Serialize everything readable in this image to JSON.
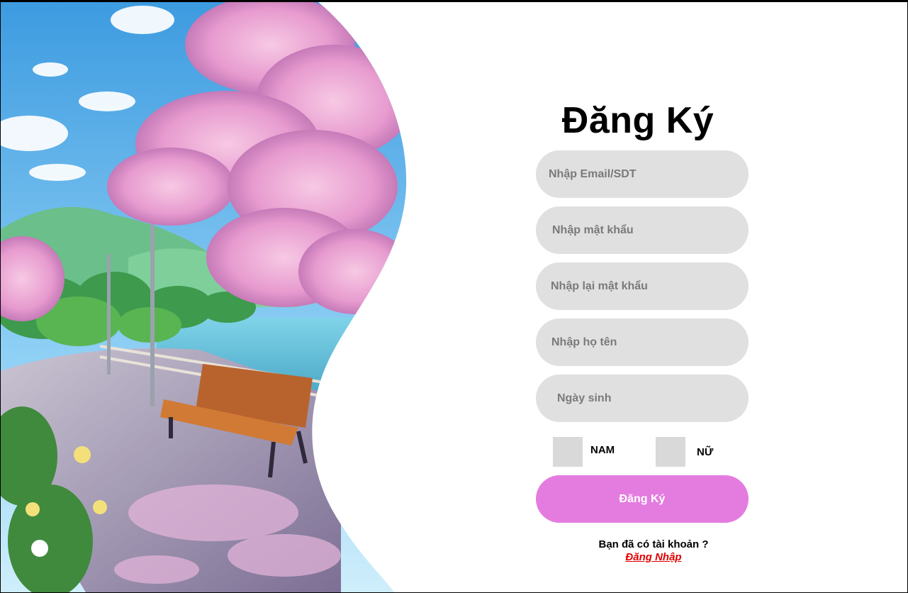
{
  "form": {
    "title": "Đăng Ký",
    "email_placeholder": "Nhập Email/SDT",
    "password_placeholder": "Nhập mật khẩu",
    "confirm_password_placeholder": "Nhập lại mật khẩu",
    "fullname_placeholder": "Nhập họ tên",
    "birthday_placeholder": "Ngày sinh",
    "gender_male_label": "NAM",
    "gender_female_label": "NỮ",
    "submit_label": "Đăng Ký",
    "have_account_text": "Bạn đã có tài khoản ?",
    "login_link_label": "Đăng Nhập"
  },
  "colors": {
    "field_bg": "#e0e0e0",
    "checkbox_bg": "#d9d9d9",
    "submit_bg": "#e47ce0",
    "link": "#e00000"
  },
  "hero": {
    "image": "anime-park-illustration"
  }
}
